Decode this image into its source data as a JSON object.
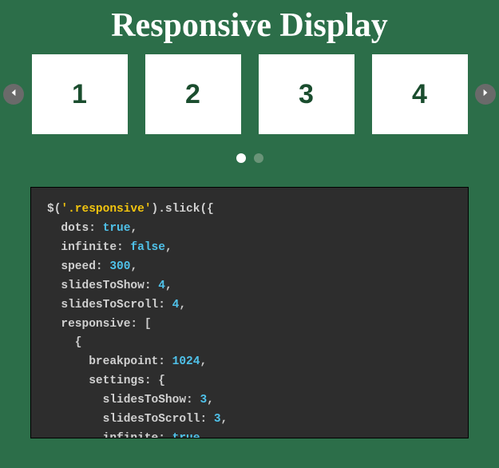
{
  "title": "Responsive Display",
  "slides": [
    "1",
    "2",
    "3",
    "4"
  ],
  "dots": {
    "count": 2,
    "active_index": 0
  },
  "code_tokens": [
    [
      [
        "fn",
        "$("
      ],
      [
        "sel",
        "'.responsive'"
      ],
      [
        "fn",
        ").slick({"
      ]
    ],
    [
      [
        "key",
        "  dots"
      ],
      [
        "punct",
        ": "
      ],
      [
        "bool",
        "true"
      ],
      [
        "punct",
        ","
      ]
    ],
    [
      [
        "key",
        "  infinite"
      ],
      [
        "punct",
        ": "
      ],
      [
        "bool",
        "false"
      ],
      [
        "punct",
        ","
      ]
    ],
    [
      [
        "key",
        "  speed"
      ],
      [
        "punct",
        ": "
      ],
      [
        "num",
        "300"
      ],
      [
        "punct",
        ","
      ]
    ],
    [
      [
        "key",
        "  slidesToShow"
      ],
      [
        "punct",
        ": "
      ],
      [
        "num",
        "4"
      ],
      [
        "punct",
        ","
      ]
    ],
    [
      [
        "key",
        "  slidesToScroll"
      ],
      [
        "punct",
        ": "
      ],
      [
        "num",
        "4"
      ],
      [
        "punct",
        ","
      ]
    ],
    [
      [
        "key",
        "  responsive"
      ],
      [
        "punct",
        ": ["
      ]
    ],
    [
      [
        "punct",
        "    {"
      ]
    ],
    [
      [
        "key",
        "      breakpoint"
      ],
      [
        "punct",
        ": "
      ],
      [
        "num",
        "1024"
      ],
      [
        "punct",
        ","
      ]
    ],
    [
      [
        "key",
        "      settings"
      ],
      [
        "punct",
        ": {"
      ]
    ],
    [
      [
        "key",
        "        slidesToShow"
      ],
      [
        "punct",
        ": "
      ],
      [
        "num",
        "3"
      ],
      [
        "punct",
        ","
      ]
    ],
    [
      [
        "key",
        "        slidesToScroll"
      ],
      [
        "punct",
        ": "
      ],
      [
        "num",
        "3"
      ],
      [
        "punct",
        ","
      ]
    ],
    [
      [
        "key",
        "        infinite"
      ],
      [
        "punct",
        ": "
      ],
      [
        "bool",
        "true"
      ],
      [
        "punct",
        ","
      ]
    ]
  ]
}
